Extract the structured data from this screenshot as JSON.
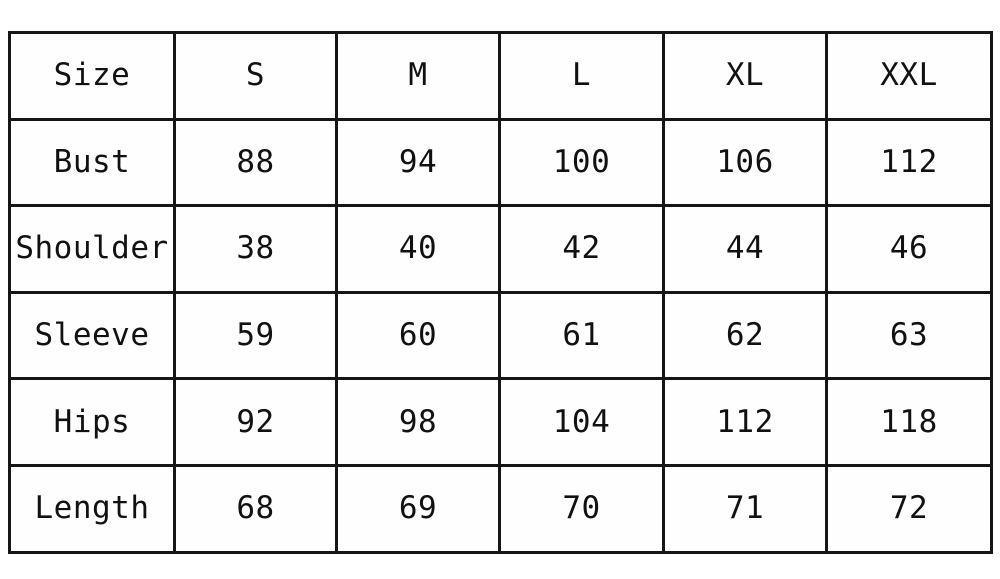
{
  "page": {
    "background_color": "#ffffff",
    "border_color": "#161616",
    "cell_background": "#fefefe",
    "text_color": "#111111"
  },
  "table": {
    "name": "garment-size-chart",
    "corner_label": "Size",
    "columns": [
      "Size",
      "S",
      "M",
      "L",
      "XL",
      "XXL"
    ],
    "size_labels": [
      "S",
      "M",
      "L",
      "XL",
      "XXL"
    ],
    "rows": [
      {
        "label": "Bust",
        "values": [
          "88",
          "94",
          "100",
          "106",
          "112"
        ]
      },
      {
        "label": "Shoulder",
        "values": [
          "38",
          "40",
          "42",
          "44",
          "46"
        ]
      },
      {
        "label": "Sleeve",
        "values": [
          "59",
          "60",
          "61",
          "62",
          "63"
        ]
      },
      {
        "label": "Hips",
        "values": [
          "92",
          "98",
          "104",
          "112",
          "118"
        ]
      },
      {
        "label": "Length",
        "values": [
          "68",
          "69",
          "70",
          "71",
          "72"
        ]
      }
    ]
  },
  "chart_data": {
    "type": "table",
    "title": "",
    "categories": [
      "S",
      "M",
      "L",
      "XL",
      "XXL"
    ],
    "series": [
      {
        "name": "Bust",
        "values": [
          88,
          94,
          100,
          106,
          112
        ]
      },
      {
        "name": "Shoulder",
        "values": [
          38,
          40,
          42,
          44,
          46
        ]
      },
      {
        "name": "Sleeve",
        "values": [
          59,
          60,
          61,
          62,
          63
        ]
      },
      {
        "name": "Hips",
        "values": [
          92,
          98,
          104,
          112,
          118
        ]
      },
      {
        "name": "Length",
        "values": [
          68,
          69,
          70,
          71,
          72
        ]
      }
    ],
    "xlabel": "Size",
    "ylabel": "",
    "grid": true,
    "legend": "none"
  }
}
